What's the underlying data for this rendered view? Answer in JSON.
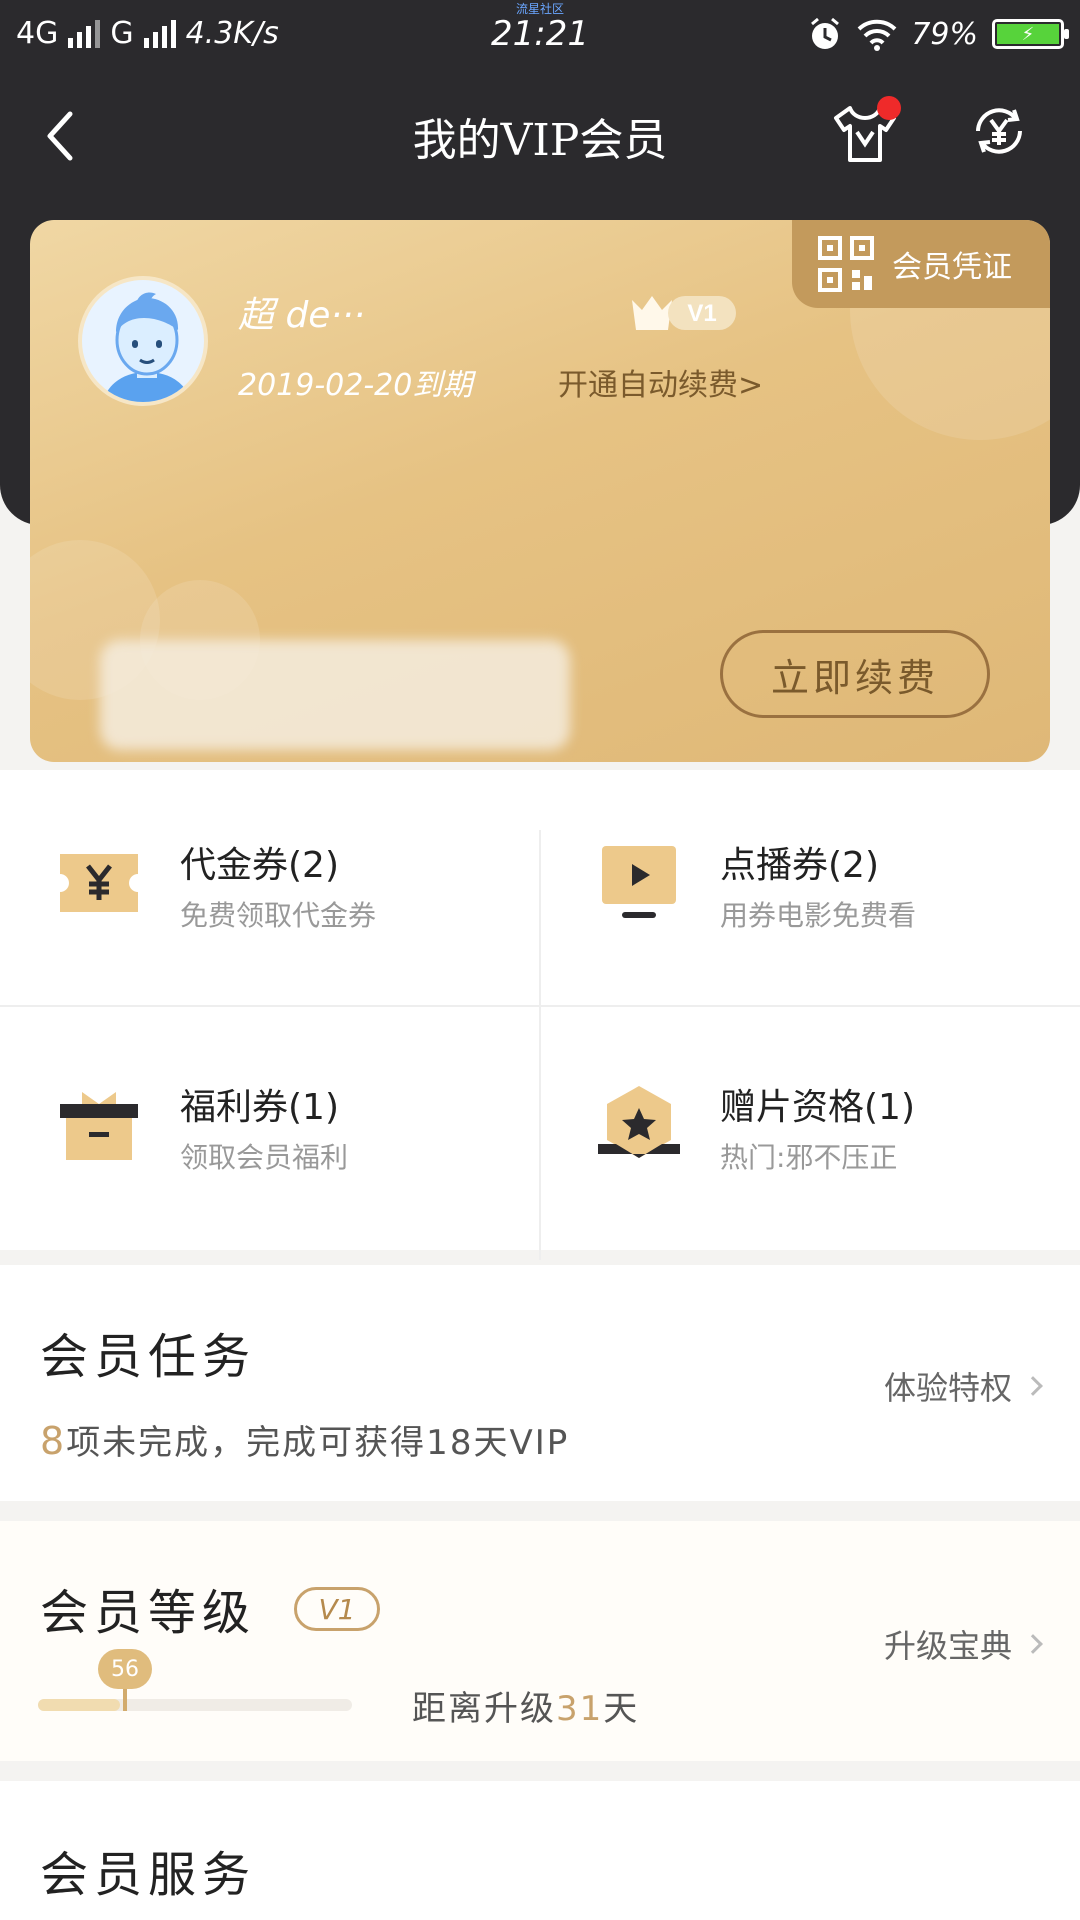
{
  "status_bar": {
    "network1": "4G",
    "network2": "G",
    "speed": "4.3K/s",
    "carrier_tiny": "流星社区",
    "time": "21:21",
    "battery": "79%"
  },
  "header": {
    "title": "我的VIP会员"
  },
  "card": {
    "certificate_label": "会员凭证",
    "user_name": "超                de···",
    "level_badge": "V1",
    "expire_text": "2019-02-20到期",
    "autopay_link": "开通自动续费>",
    "renew_button": "立即续费"
  },
  "coupons": [
    {
      "title": "代金券(2)",
      "subtitle": "免费领取代金券",
      "icon": "yen-ticket-icon"
    },
    {
      "title": "点播券(2)",
      "subtitle": "用券电影免费看",
      "icon": "play-screen-icon"
    },
    {
      "title": "福利券(1)",
      "subtitle": "领取会员福利",
      "icon": "gift-box-icon"
    },
    {
      "title": "赠片资格(1)",
      "subtitle": "热门:邪不压正",
      "icon": "star-badge-icon"
    }
  ],
  "tasks": {
    "title": "会员任务",
    "link": "体验特权",
    "count": "8",
    "desc": "项未完成，完成可获得18天VIP"
  },
  "level": {
    "title": "会员等级",
    "badge": "V1",
    "link": "升级宝典",
    "progress_value": "56",
    "progress_fraction": 0.26,
    "desc_prefix": "距离升级",
    "days": "31",
    "desc_suffix": "天"
  },
  "services": {
    "title": "会员服务"
  },
  "colors": {
    "header_bg": "#2b2a2d",
    "gold": "#c8a26c",
    "card_gold": "#e6c283"
  }
}
